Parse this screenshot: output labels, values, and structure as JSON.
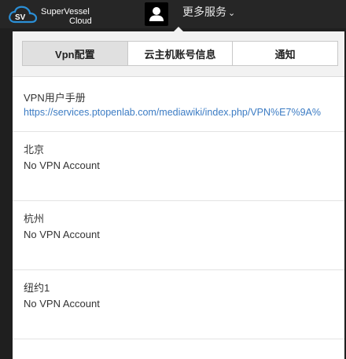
{
  "header": {
    "brand_line1": "SuperVessel",
    "brand_line2": "Cloud",
    "more_services": "更多服务",
    "colors": {
      "bar": "#262626",
      "logo_blue": "#2b8fd6"
    }
  },
  "tabs": [
    {
      "label": "Vpn配置",
      "active": true
    },
    {
      "label": "云主机账号信息",
      "active": false
    },
    {
      "label": "通知",
      "active": false
    }
  ],
  "manual": {
    "title": "VPN用户手册",
    "link": "https://services.ptopenlab.com/mediawiki/index.php/VPN%E7%9A%"
  },
  "regions": [
    {
      "name": "北京",
      "status": "No VPN Account"
    },
    {
      "name": "杭州",
      "status": "No VPN Account"
    },
    {
      "name": "纽约1",
      "status": "No VPN Account"
    }
  ]
}
